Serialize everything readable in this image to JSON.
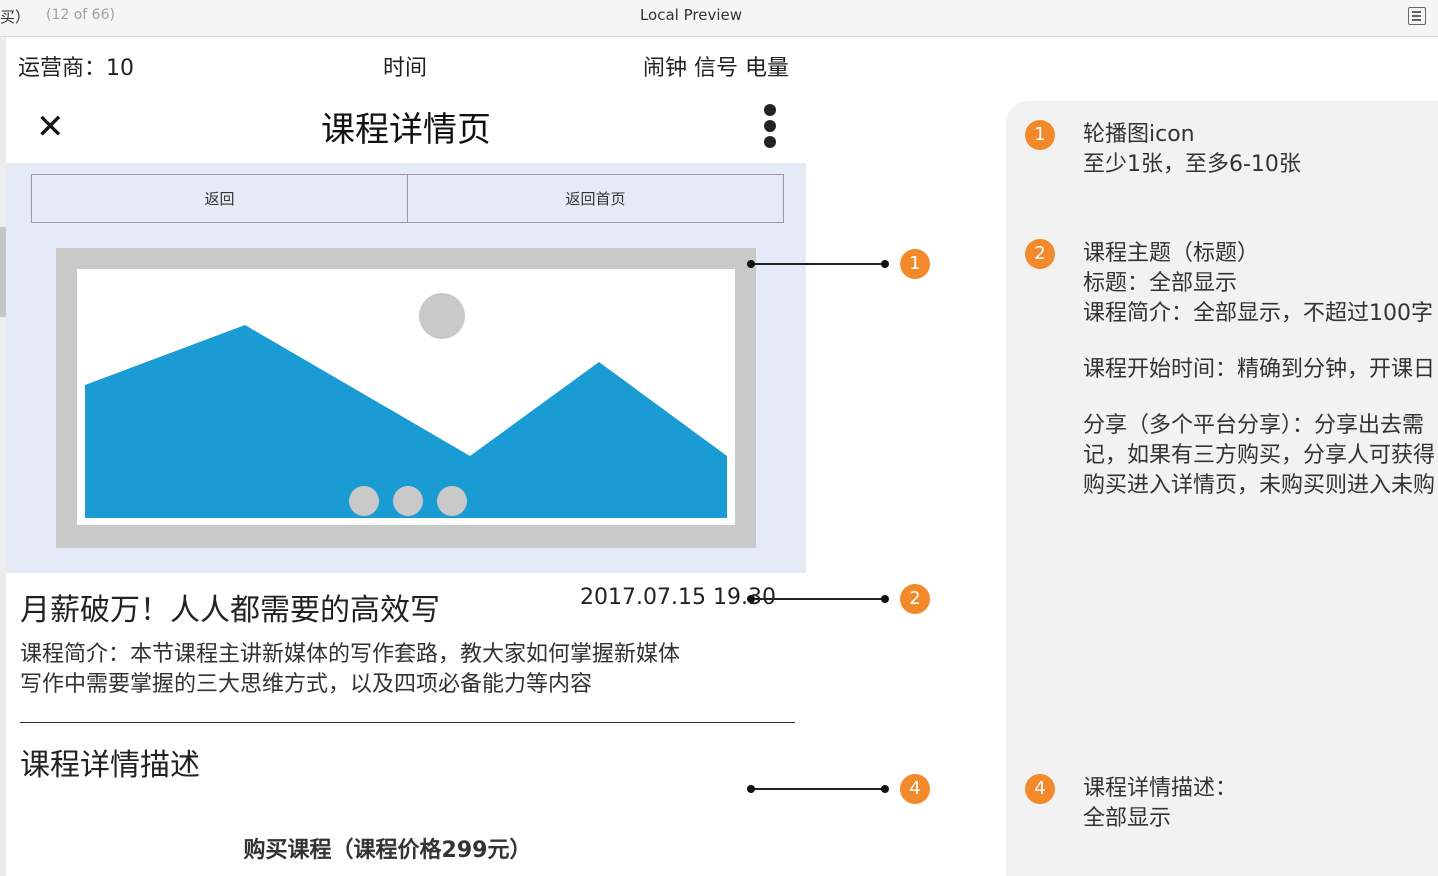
{
  "preview_bar": {
    "left_text": "买）",
    "page_count": "(12 of 66)",
    "title": "Local Preview",
    "menu_icon": "list-icon"
  },
  "status_bar": {
    "carrier": "运营商：10",
    "time": "时间",
    "indicators": "闹钟 信号 电量"
  },
  "nav": {
    "close_icon": "close-icon",
    "title": "课程详情页",
    "more_icon": "more-vertical-icon"
  },
  "buttons": {
    "back": "返回",
    "home": "返回首页"
  },
  "carousel": {
    "image_icon": "image-placeholder-icon",
    "active_slide": 1,
    "slide_dots": 3
  },
  "course": {
    "title": "月薪破万！人人都需要的高效写",
    "time": "2017.07.15 19.30",
    "intro_line1": "课程简介：本节课程主讲新媒体的写作套路，教大家如何掌握新媒体",
    "intro_line2": "写作中需要掌握的三大思维方式，以及四项必备能力等内容",
    "detail_heading": "课程详情描述",
    "buy_label": "购买课程（课程价格299元）"
  },
  "markers": [
    "1",
    "2",
    "4"
  ],
  "notes": {
    "n1": {
      "num": "1",
      "lines": [
        "轮播图icon",
        "至少1张，至多6-10张"
      ]
    },
    "n2": {
      "num": "2",
      "lines": [
        "课程主题（标题）",
        "标题：全部显示",
        "课程简介：全部显示，不超过100字",
        "课程开始时间：精确到分钟，开课日",
        "分享（多个平台分享）：分享出去需",
        "记，如果有三方购买，分享人可获得",
        "购买进入详情页，未购买则进入未购"
      ]
    },
    "n4": {
      "num": "4",
      "lines": [
        "课程详情描述：",
        "全部显示"
      ]
    }
  },
  "colors": {
    "marker": "#f28a2b",
    "banner_bg": "#e4ebf7",
    "mountain": "#1a9bd3",
    "placeholder_gray": "#c9c9c9",
    "notes_bg": "#f2f2f2"
  }
}
